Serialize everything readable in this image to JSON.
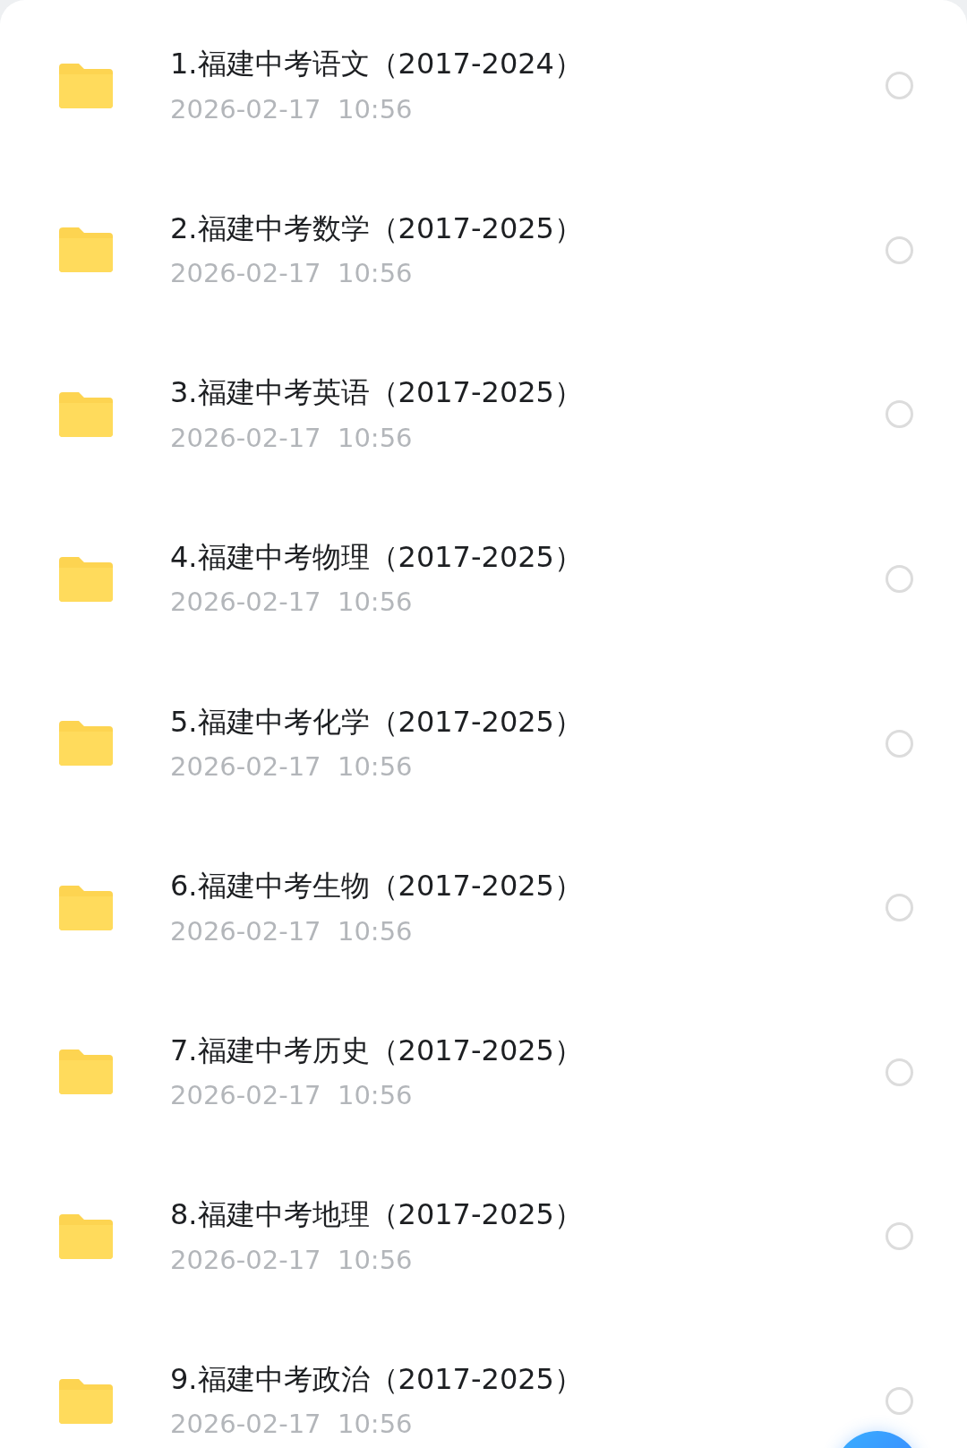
{
  "files": [
    {
      "name": "1.福建中考语文（2017-2024）",
      "date": "2026-02-17  10:56",
      "selected": false
    },
    {
      "name": "2.福建中考数学（2017-2025）",
      "date": "2026-02-17  10:56",
      "selected": false
    },
    {
      "name": "3.福建中考英语（2017-2025）",
      "date": "2026-02-17  10:56",
      "selected": false
    },
    {
      "name": "4.福建中考物理（2017-2025）",
      "date": "2026-02-17  10:56",
      "selected": false
    },
    {
      "name": "5.福建中考化学（2017-2025）",
      "date": "2026-02-17  10:56",
      "selected": false
    },
    {
      "name": "6.福建中考生物（2017-2025）",
      "date": "2026-02-17  10:56",
      "selected": false
    },
    {
      "name": "7.福建中考历史（2017-2025）",
      "date": "2026-02-17  10:56",
      "selected": false
    },
    {
      "name": "8.福建中考地理（2017-2025）",
      "date": "2026-02-17  10:56",
      "selected": false
    },
    {
      "name": "9.福建中考政治（2017-2025）",
      "date": "2026-02-17  10:56",
      "selected": false
    }
  ]
}
